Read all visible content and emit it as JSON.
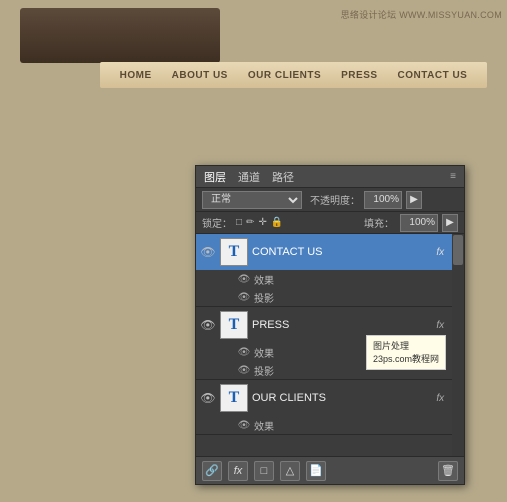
{
  "banner": {
    "watermark": "思络设计论坛 WWW.MISSYUAN.COM"
  },
  "nav": {
    "items": [
      {
        "label": "HOME",
        "active": false
      },
      {
        "label": "ABOUT US",
        "active": false
      },
      {
        "label": "OUR CLIENTS",
        "active": false
      },
      {
        "label": "PRESS",
        "active": false
      },
      {
        "label": "CONTACT US",
        "active": false
      }
    ]
  },
  "ps_panel": {
    "tabs": [
      "图层",
      "通道",
      "路径"
    ],
    "active_tab": "图层",
    "blend_mode": "正常",
    "opacity_label": "不透明度：",
    "opacity_value": "100%",
    "lock_label": "锁定：",
    "fill_label": "填充：",
    "fill_value": "100%",
    "layers": [
      {
        "name": "CONTACT US",
        "selected": true,
        "type": "T",
        "has_fx": true,
        "fx_label": "fx",
        "sub": [
          {
            "label": "效果"
          },
          {
            "label": "投影"
          }
        ]
      },
      {
        "name": "PRESS",
        "selected": false,
        "type": "T",
        "has_fx": true,
        "fx_label": "fx",
        "sub": [
          {
            "label": "效果"
          },
          {
            "label": "投影"
          }
        ]
      },
      {
        "name": "OUR CLIENTS",
        "selected": false,
        "type": "T",
        "has_fx": true,
        "fx_label": "fx",
        "sub": [
          {
            "label": "效果"
          }
        ]
      }
    ],
    "tooltip": {
      "line1": "图片处理",
      "line2": "23ps.com教程网"
    },
    "toolbar_buttons": [
      "⊕",
      "fx",
      "□",
      "△",
      "✕"
    ]
  }
}
